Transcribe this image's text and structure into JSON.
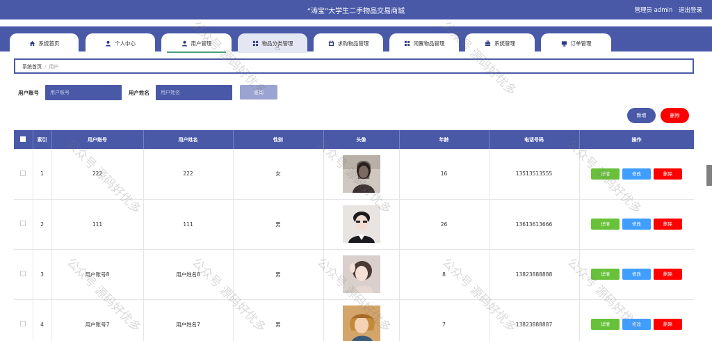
{
  "header": {
    "title": "“涛宝”大学生二手物品交易商城",
    "admin_label": "管理员 admin",
    "logout_label": "退出登录"
  },
  "nav": {
    "tabs": [
      {
        "label": "系统首页",
        "icon": "home-icon"
      },
      {
        "label": "个人中心",
        "icon": "user-icon"
      },
      {
        "label": "用户管理",
        "icon": "user-icon"
      },
      {
        "label": "物品分类管理",
        "icon": "grid-icon"
      },
      {
        "label": "求购物品管理",
        "icon": "calendar-icon"
      },
      {
        "label": "闲置物品管理",
        "icon": "grid-icon"
      },
      {
        "label": "系统管理",
        "icon": "briefcase-icon"
      },
      {
        "label": "订单管理",
        "icon": "monitor-icon"
      }
    ]
  },
  "breadcrumb": {
    "home": "系统首页",
    "current": "用户"
  },
  "filters": {
    "account_label": "用户账号",
    "account_placeholder": "用户账号",
    "name_label": "用户姓名",
    "name_placeholder": "用户姓名",
    "search_label": "查询"
  },
  "actions": {
    "add_label": "新增",
    "delete_label": "删除"
  },
  "table": {
    "columns": [
      "索引",
      "用户账号",
      "用户姓名",
      "性别",
      "头像",
      "年龄",
      "电话号码",
      "操作"
    ],
    "rows": [
      {
        "index": "1",
        "account": "222",
        "name": "222",
        "gender": "女",
        "age": "16",
        "phone": "13513513555"
      },
      {
        "index": "2",
        "account": "111",
        "name": "111",
        "gender": "男",
        "age": "26",
        "phone": "13613613666"
      },
      {
        "index": "3",
        "account": "用户账号8",
        "name": "用户姓名8",
        "gender": "男",
        "age": "8",
        "phone": "13823888888"
      },
      {
        "index": "4",
        "account": "用户账号7",
        "name": "用户姓名7",
        "gender": "男",
        "age": "7",
        "phone": "13823888887"
      }
    ],
    "op_detail": "详情",
    "op_edit": "修改",
    "op_delete": "删除"
  },
  "watermark_text": "公众号  源码好优多",
  "colors": {
    "primary": "#4959a8",
    "detail": "#67c23a",
    "edit": "#409eff",
    "danger": "#ff0000"
  }
}
